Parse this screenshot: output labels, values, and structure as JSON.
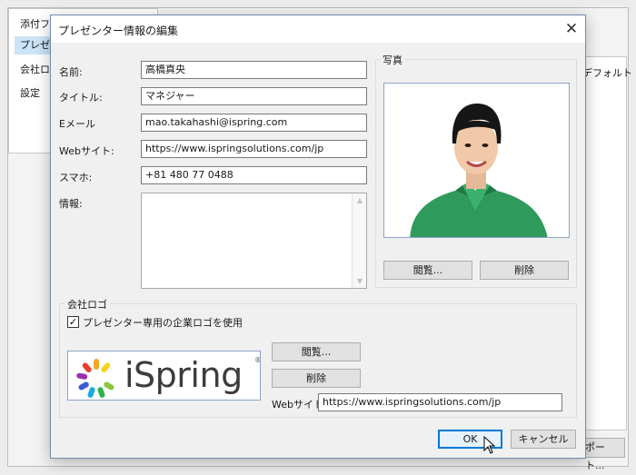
{
  "background_window": {
    "sidebar_items": [
      "添付ファ",
      "プレゼン",
      "会社ロゴ",
      "設定"
    ],
    "right_label": "デフォルト",
    "bottom_button": "ポート..."
  },
  "dialog": {
    "title": "プレゼンター情報の編集",
    "close_glyph": "✕",
    "labels": {
      "name": "名前:",
      "title": "タイトル:",
      "email": "Eメール",
      "website": "Webサイト:",
      "phone": "スマホ:",
      "info": "情報:"
    },
    "fields": {
      "name": "高橋真央",
      "title": "マネジャー",
      "email": "mao.takahashi@ispring.com",
      "website": "https://www.ispringsolutions.com/jp",
      "phone": "+81 480 77 0488",
      "info": ""
    },
    "photo": {
      "group_title": "写真",
      "browse_button": "閲覧...",
      "delete_button": "削除"
    },
    "company_logo": {
      "group_title": "会社ロゴ",
      "checkbox_label": "プレゼンター専用の企業ロゴを使用",
      "checkbox_checked": true,
      "checkbox_glyph": "✓",
      "logo_text": "iSpring",
      "logo_reg": "®",
      "browse_button": "閲覧...",
      "delete_button": "削除",
      "website_label": "Webサイト:",
      "website_value": "https://www.ispringsolutions.com/jp"
    },
    "footer": {
      "ok_button": "OK",
      "cancel_button": "キャンセル"
    }
  },
  "colors": {
    "accent": "#0078d7",
    "selected_bg": "#cce4f7"
  }
}
